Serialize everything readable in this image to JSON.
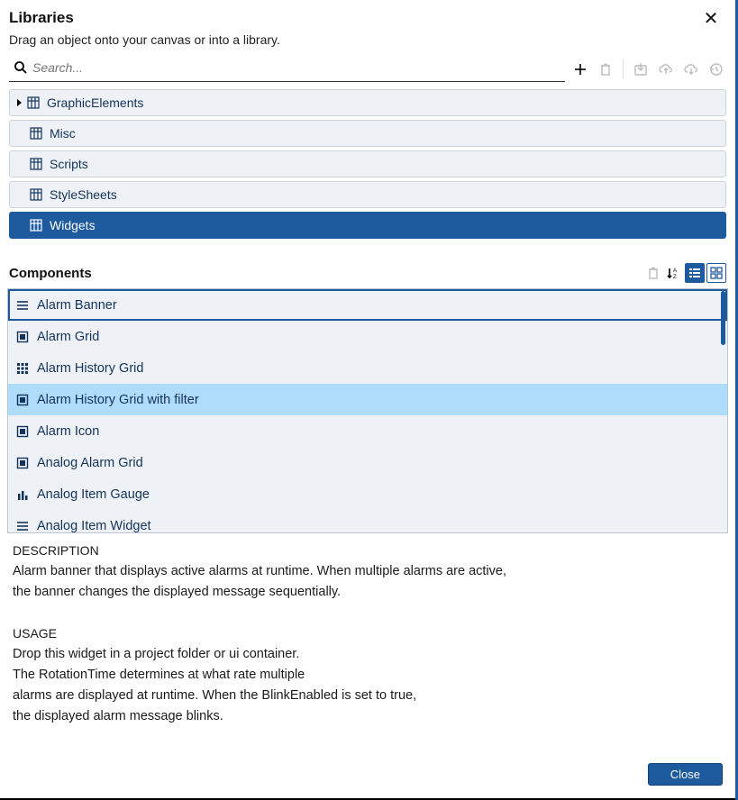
{
  "header": {
    "title": "Libraries",
    "subtitle": "Drag an object onto your canvas or into a library."
  },
  "search": {
    "placeholder": "Search..."
  },
  "libraries": [
    {
      "label": "GraphicElements",
      "expandable": true,
      "selected": false
    },
    {
      "label": "Misc",
      "expandable": false,
      "selected": false
    },
    {
      "label": "Scripts",
      "expandable": false,
      "selected": false
    },
    {
      "label": "StyleSheets",
      "expandable": false,
      "selected": false
    },
    {
      "label": "Widgets",
      "expandable": false,
      "selected": true
    }
  ],
  "components_heading": "Components",
  "components": [
    {
      "label": "Alarm Banner",
      "icon": "list",
      "selected": true,
      "hover": false
    },
    {
      "label": "Alarm Grid",
      "icon": "widget",
      "selected": false,
      "hover": false
    },
    {
      "label": "Alarm History Grid",
      "icon": "grid9",
      "selected": false,
      "hover": false
    },
    {
      "label": "Alarm History Grid with filter",
      "icon": "widget",
      "selected": false,
      "hover": true
    },
    {
      "label": "Alarm Icon",
      "icon": "widget",
      "selected": false,
      "hover": false
    },
    {
      "label": "Analog Alarm Grid",
      "icon": "widget",
      "selected": false,
      "hover": false
    },
    {
      "label": "Analog Item Gauge",
      "icon": "bars",
      "selected": false,
      "hover": false
    },
    {
      "label": "Analog Item Widget",
      "icon": "list",
      "selected": false,
      "hover": false
    }
  ],
  "description": {
    "desc_heading": "DESCRIPTION",
    "desc_l1": "Alarm banner that displays active alarms at runtime. When multiple alarms are active,",
    "desc_l2": "the banner changes the displayed message sequentially.",
    "usage_heading": "USAGE",
    "usage_l1": "Drop this widget in a project folder or ui container.",
    "usage_l2": "The RotationTime  determines at what rate multiple",
    "usage_l3": "alarms are displayed at runtime. When the BlinkEnabled is set to true,",
    "usage_l4": "the displayed alarm message blinks."
  },
  "footer": {
    "close_label": "Close"
  }
}
